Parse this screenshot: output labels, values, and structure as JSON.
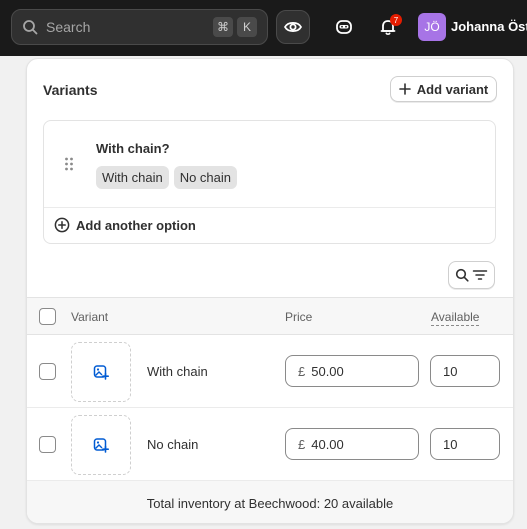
{
  "topbar": {
    "search_placeholder": "Search",
    "shortcut_keys": [
      "⌘",
      "K"
    ],
    "notification_count": "7",
    "avatar_initials": "JÖ",
    "user_name": "Johanna Öst"
  },
  "variants": {
    "title": "Variants",
    "add_variant_label": "Add variant",
    "option": {
      "name": "With chain?",
      "values": [
        "With chain",
        "No chain"
      ]
    },
    "add_another_option_label": "Add another option",
    "table": {
      "headers": {
        "variant": "Variant",
        "price": "Price",
        "available": "Available"
      },
      "rows": [
        {
          "name": "With chain",
          "currency": "£",
          "price": "50.00",
          "available": "10"
        },
        {
          "name": "No chain",
          "currency": "£",
          "price": "40.00",
          "available": "10"
        }
      ]
    },
    "footer_text": "Total inventory at Beechwood: 20 available"
  },
  "colors": {
    "topbar_bg": "#1a1a1a",
    "avatar_bg": "#a774e6",
    "badge_bg": "#e51c00",
    "link_blue": "#005bd3"
  }
}
